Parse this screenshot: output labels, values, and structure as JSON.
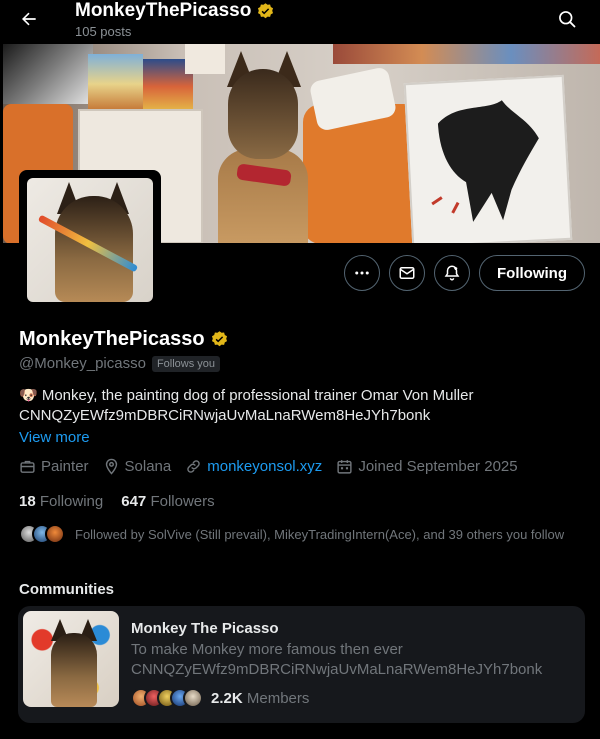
{
  "header": {
    "title": "MonkeyThePicasso",
    "posts": "105 posts"
  },
  "colors": {
    "background": "#000000",
    "accent_link": "#1d9bf0",
    "verified_gold": "#e2b719",
    "muted": "#71767b",
    "card": "#16181c"
  },
  "actions": {
    "following_label": "Following"
  },
  "profile": {
    "name": "MonkeyThePicasso",
    "handle": "@Monkey_picasso",
    "follows_you": "Follows you",
    "bio_line1": "🐶 Monkey, the painting dog of professional trainer Omar Von Muller",
    "bio_line2": "CNNQZyEWfz9mDBRCiRNwjaUvMaLnaRWem8HeJYh7bonk",
    "view_more": "View more",
    "profession": "Painter",
    "location": "Solana",
    "website": "monkeyonsol.xyz",
    "joined": "Joined September 2025",
    "following_count": "18",
    "following_label": "Following",
    "followers_count": "647",
    "followers_label": "Followers",
    "followed_by": "Followed by SolVive (Still prevail), MikeyTradingIntern(Ace), and 39 others you follow"
  },
  "communities": {
    "title": "Communities",
    "card": {
      "name": "Monkey The Picasso",
      "desc_line1": "To make Monkey more famous then ever",
      "desc_line2": "CNNQZyEWfz9mDBRCiRNwjaUvMaLnaRWem8HeJYh7bonk",
      "members_count": "2.2K",
      "members_label": "Members"
    }
  },
  "icons": [
    "back-arrow-icon",
    "search-icon",
    "verified-badge-icon",
    "more-icon",
    "message-icon",
    "notification-bell-icon",
    "briefcase-icon",
    "location-pin-icon",
    "link-icon",
    "calendar-icon"
  ]
}
